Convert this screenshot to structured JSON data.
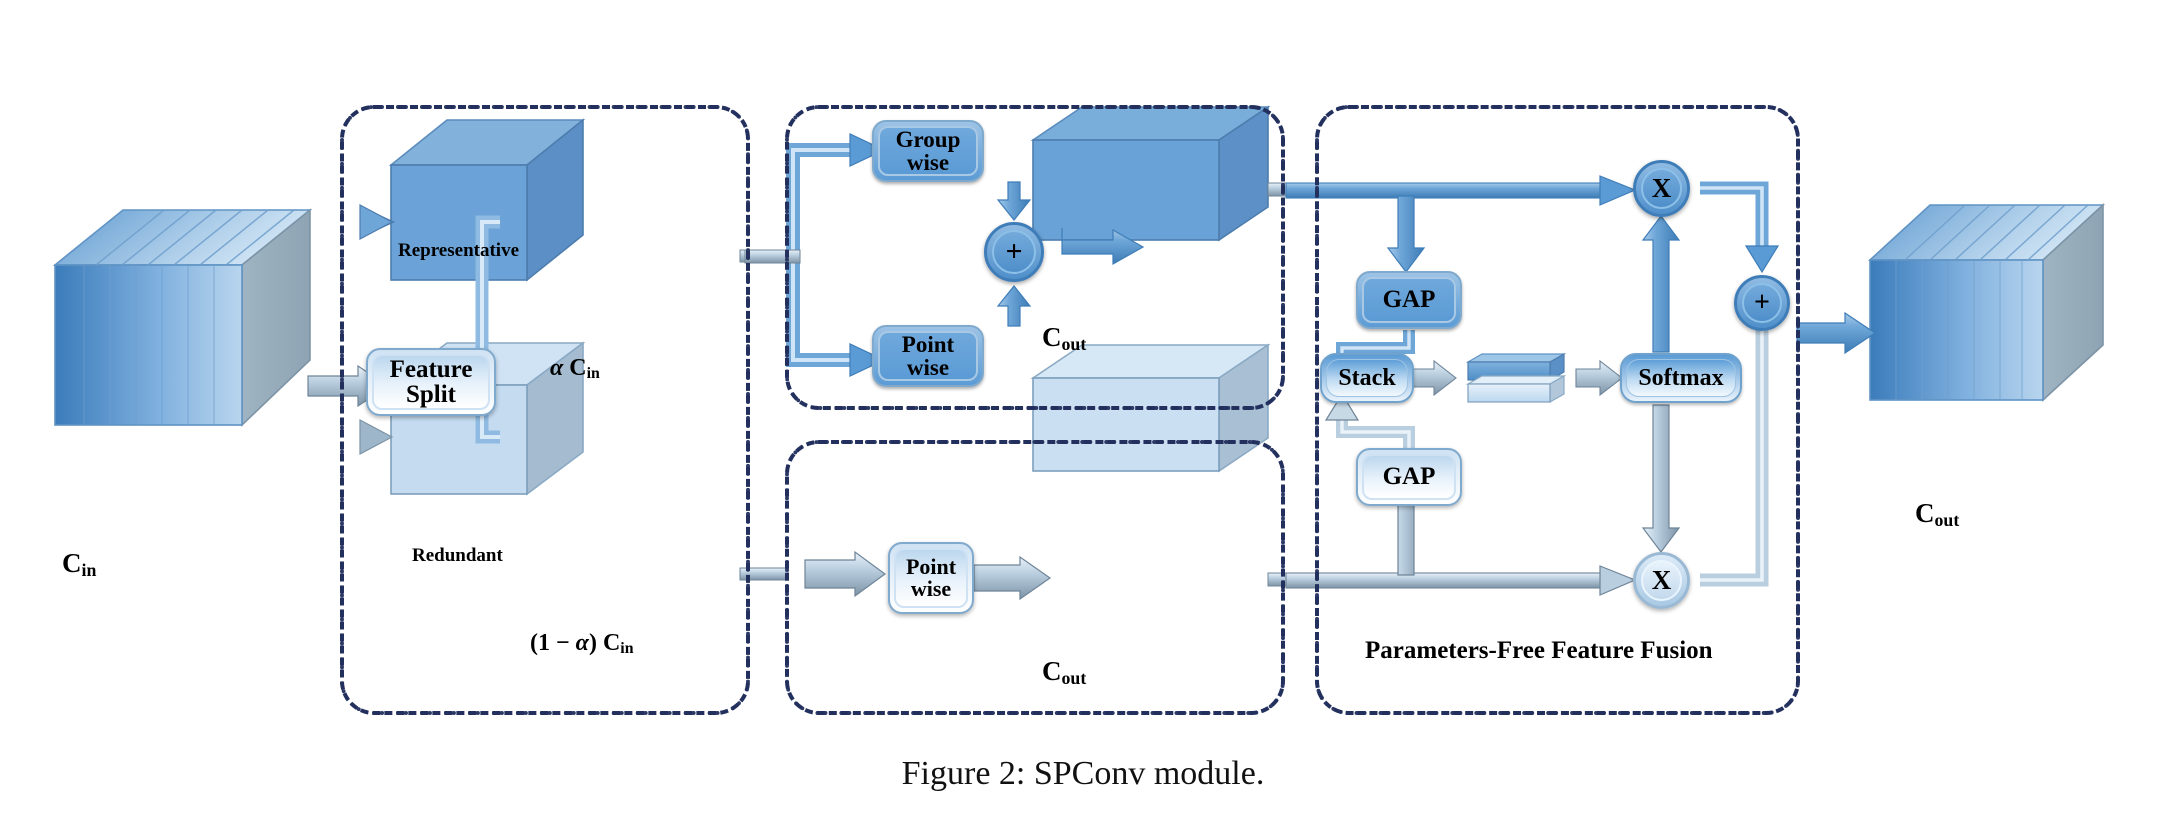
{
  "figure": {
    "caption": "Figure 2:  SPConv module.",
    "title": "SPConv module"
  },
  "input": {
    "label_main": "C",
    "label_sub": "in"
  },
  "split": {
    "box_label_line1": "Feature",
    "box_label_line2": "Split",
    "representative": {
      "cube_label": "Representative",
      "ratio_alpha": "α",
      "ratio_c": "C",
      "ratio_sub": "in"
    },
    "redundant": {
      "cube_label": "Redundant",
      "ratio_prefix": "(1 − ",
      "ratio_alpha": "α",
      "ratio_suffix": ")",
      "ratio_c": "C",
      "ratio_sub": "in"
    }
  },
  "repr_branch": {
    "group_wise_line1": "Group",
    "group_wise_line2": "wise",
    "point_wise_line1": "Point",
    "point_wise_line2": "wise",
    "add_symbol": "+",
    "out_label_main": "C",
    "out_label_sub": "out"
  },
  "redu_branch": {
    "point_wise_line1": "Point",
    "point_wise_line2": "wise",
    "out_label_main": "C",
    "out_label_sub": "out"
  },
  "fusion": {
    "title": "Parameters-Free Feature Fusion",
    "gap_top": "GAP",
    "gap_bottom": "GAP",
    "stack": "Stack",
    "softmax": "Softmax",
    "mul_top": "X",
    "mul_bottom": "X",
    "add_symbol": "+"
  },
  "output": {
    "label_main": "C",
    "label_sub": "out"
  },
  "colors": {
    "panel_border": "#23305e",
    "arrow_blue": "#5b9bd5",
    "arrow_light": "#b8cee0",
    "cube_dark_face": "#5b9bd5",
    "cube_light_face": "#c5dcf0",
    "box_fill": "#5b9bd5",
    "text": "#000000"
  }
}
